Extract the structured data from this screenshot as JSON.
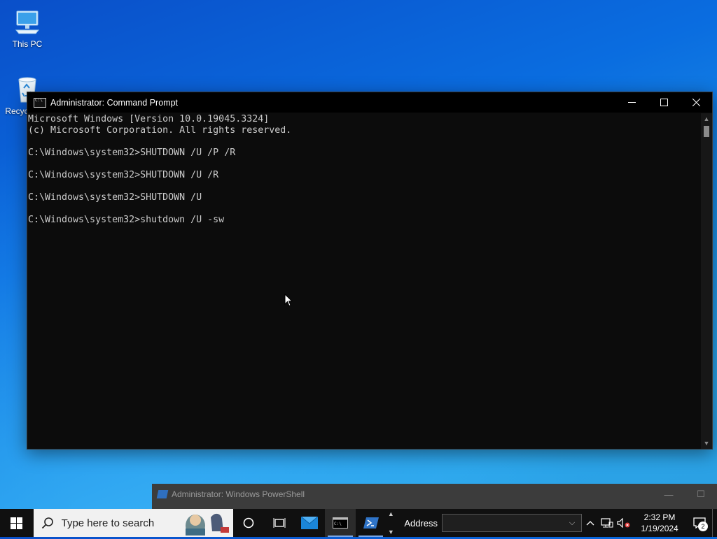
{
  "desktop": {
    "icons": [
      {
        "label": "This PC",
        "icon": "computer-icon"
      },
      {
        "label": "Recycle Bin",
        "icon": "recycle-bin-icon"
      }
    ]
  },
  "cmd_window": {
    "title": "Administrator: Command Prompt",
    "lines": [
      "Microsoft Windows [Version 10.0.19045.3324]",
      "(c) Microsoft Corporation. All rights reserved.",
      "",
      "C:\\Windows\\system32>SHUTDOWN /U /P /R",
      "",
      "C:\\Windows\\system32>SHUTDOWN /U /R",
      "",
      "C:\\Windows\\system32>SHUTDOWN /U",
      "",
      "C:\\Windows\\system32>shutdown /U -sw"
    ],
    "colors": {
      "background": "#0c0c0c",
      "text": "#cccccc"
    }
  },
  "powershell_window": {
    "title": "Administrator: Windows PowerShell"
  },
  "taskbar": {
    "search_placeholder": "Type here to search",
    "address_label": "Address",
    "address_value": "",
    "clock_time": "2:32 PM",
    "clock_date": "1/19/2024",
    "notification_count": "2",
    "pinned": [
      "cortana-icon",
      "task-view-icon",
      "mail-icon",
      "command-prompt-icon",
      "powershell-icon"
    ],
    "active_app": "command-prompt-icon"
  }
}
